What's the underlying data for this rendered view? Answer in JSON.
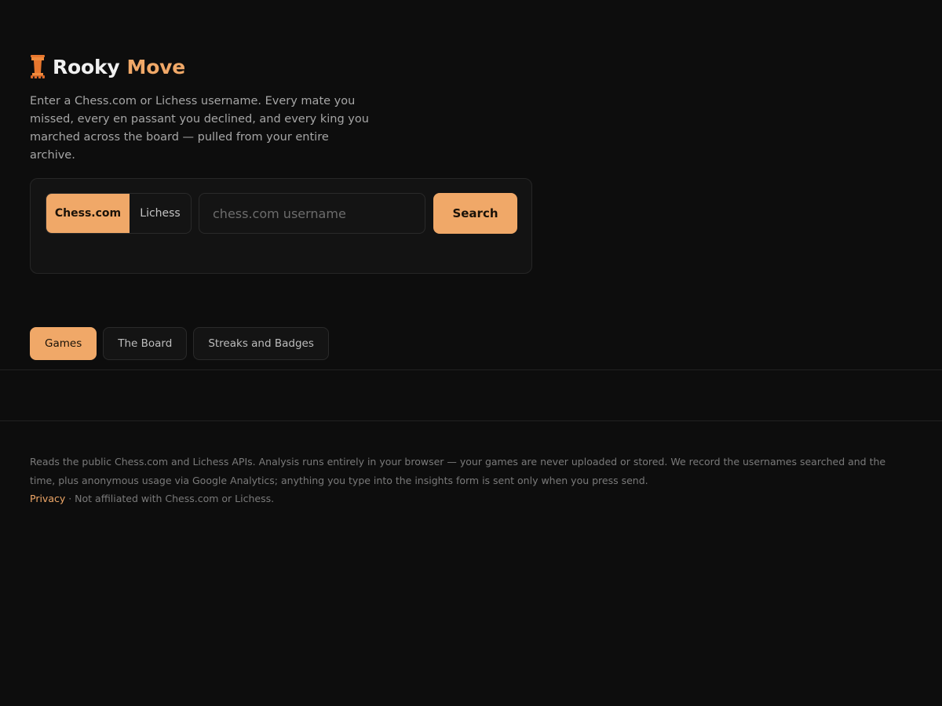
{
  "brand": {
    "name": "Rooky",
    "accent": "Move",
    "icon": "rook-icon",
    "accent_color": "#f0a868"
  },
  "tagline": "Enter a Chess.com or Lichess username. Every mate you missed, every en passant you declined, and every king you marched across the board — pulled from your entire archive.",
  "search": {
    "platforms": [
      {
        "label": "Chess.com",
        "selected": true
      },
      {
        "label": "Lichess",
        "selected": false
      }
    ],
    "placeholder": "chess.com username",
    "value": "",
    "button_label": "Search"
  },
  "tabs": [
    {
      "label": "Games",
      "active": true
    },
    {
      "label": "The Board",
      "active": false
    },
    {
      "label": "Streaks and Badges",
      "active": false
    }
  ],
  "footer": {
    "notice": "Reads the public Chess.com and Lichess APIs. Analysis runs entirely in your browser — your games are never uploaded or stored. We record the usernames searched and the time, plus anonymous usage via Google Analytics; anything you type into the insights form is sent only when you press send.",
    "privacy_label": "Privacy",
    "disclaimer": " · Not affiliated with Chess.com or Lichess."
  }
}
